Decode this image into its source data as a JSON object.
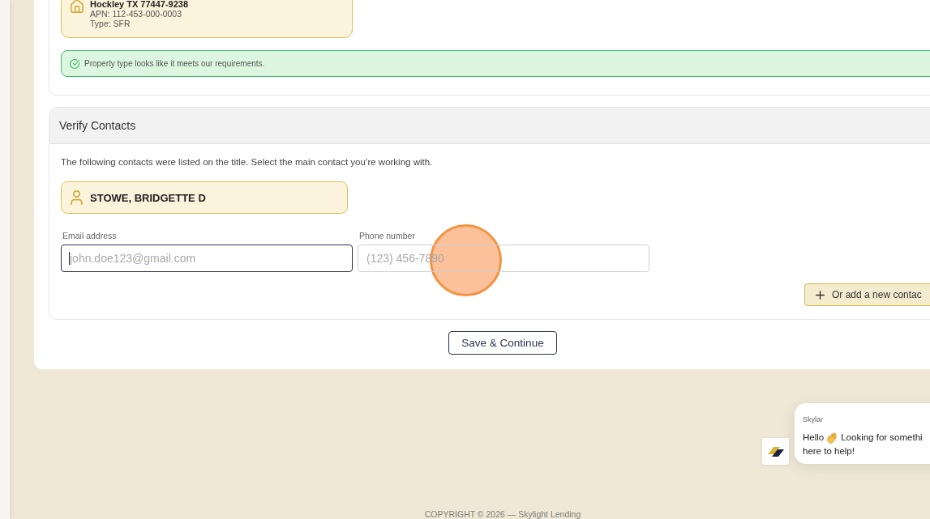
{
  "property": {
    "address": "Hockley TX 77447-9238",
    "apn": "APN: 112-453-000-0003",
    "type": "Type: SFR"
  },
  "notice": {
    "kind": "success",
    "text": "Property type looks like it meets our requirements."
  },
  "verify_contacts": {
    "title": "Verify Contacts",
    "intro": "The following contacts were listed on the title. Select the main contact you’re working with.",
    "contacts": [
      {
        "name": "STOWE, BRIDGETTE D",
        "selected": true
      }
    ],
    "fields": [
      {
        "label": "Email address",
        "placeholder": "john.doe123@gmail.com",
        "focused": true
      },
      {
        "label": "Phone number",
        "placeholder": "(123) 456-7890",
        "focused": false
      }
    ],
    "add_button": "Or add a new contac"
  },
  "save_button": "Save & Continue",
  "chat": {
    "sender": "Skylar",
    "message": [
      {
        "kind": "text",
        "text": "Hello"
      },
      {
        "kind": "emoji"
      },
      {
        "kind": "text",
        "text": "Looking for somethi"
      },
      {
        "kind": "break"
      },
      {
        "kind": "text",
        "text": "here to help!"
      }
    ]
  },
  "click_highlight": {
    "visible": true
  },
  "footer": "COPYRIGHT © 2026 — Skylight Lending"
}
